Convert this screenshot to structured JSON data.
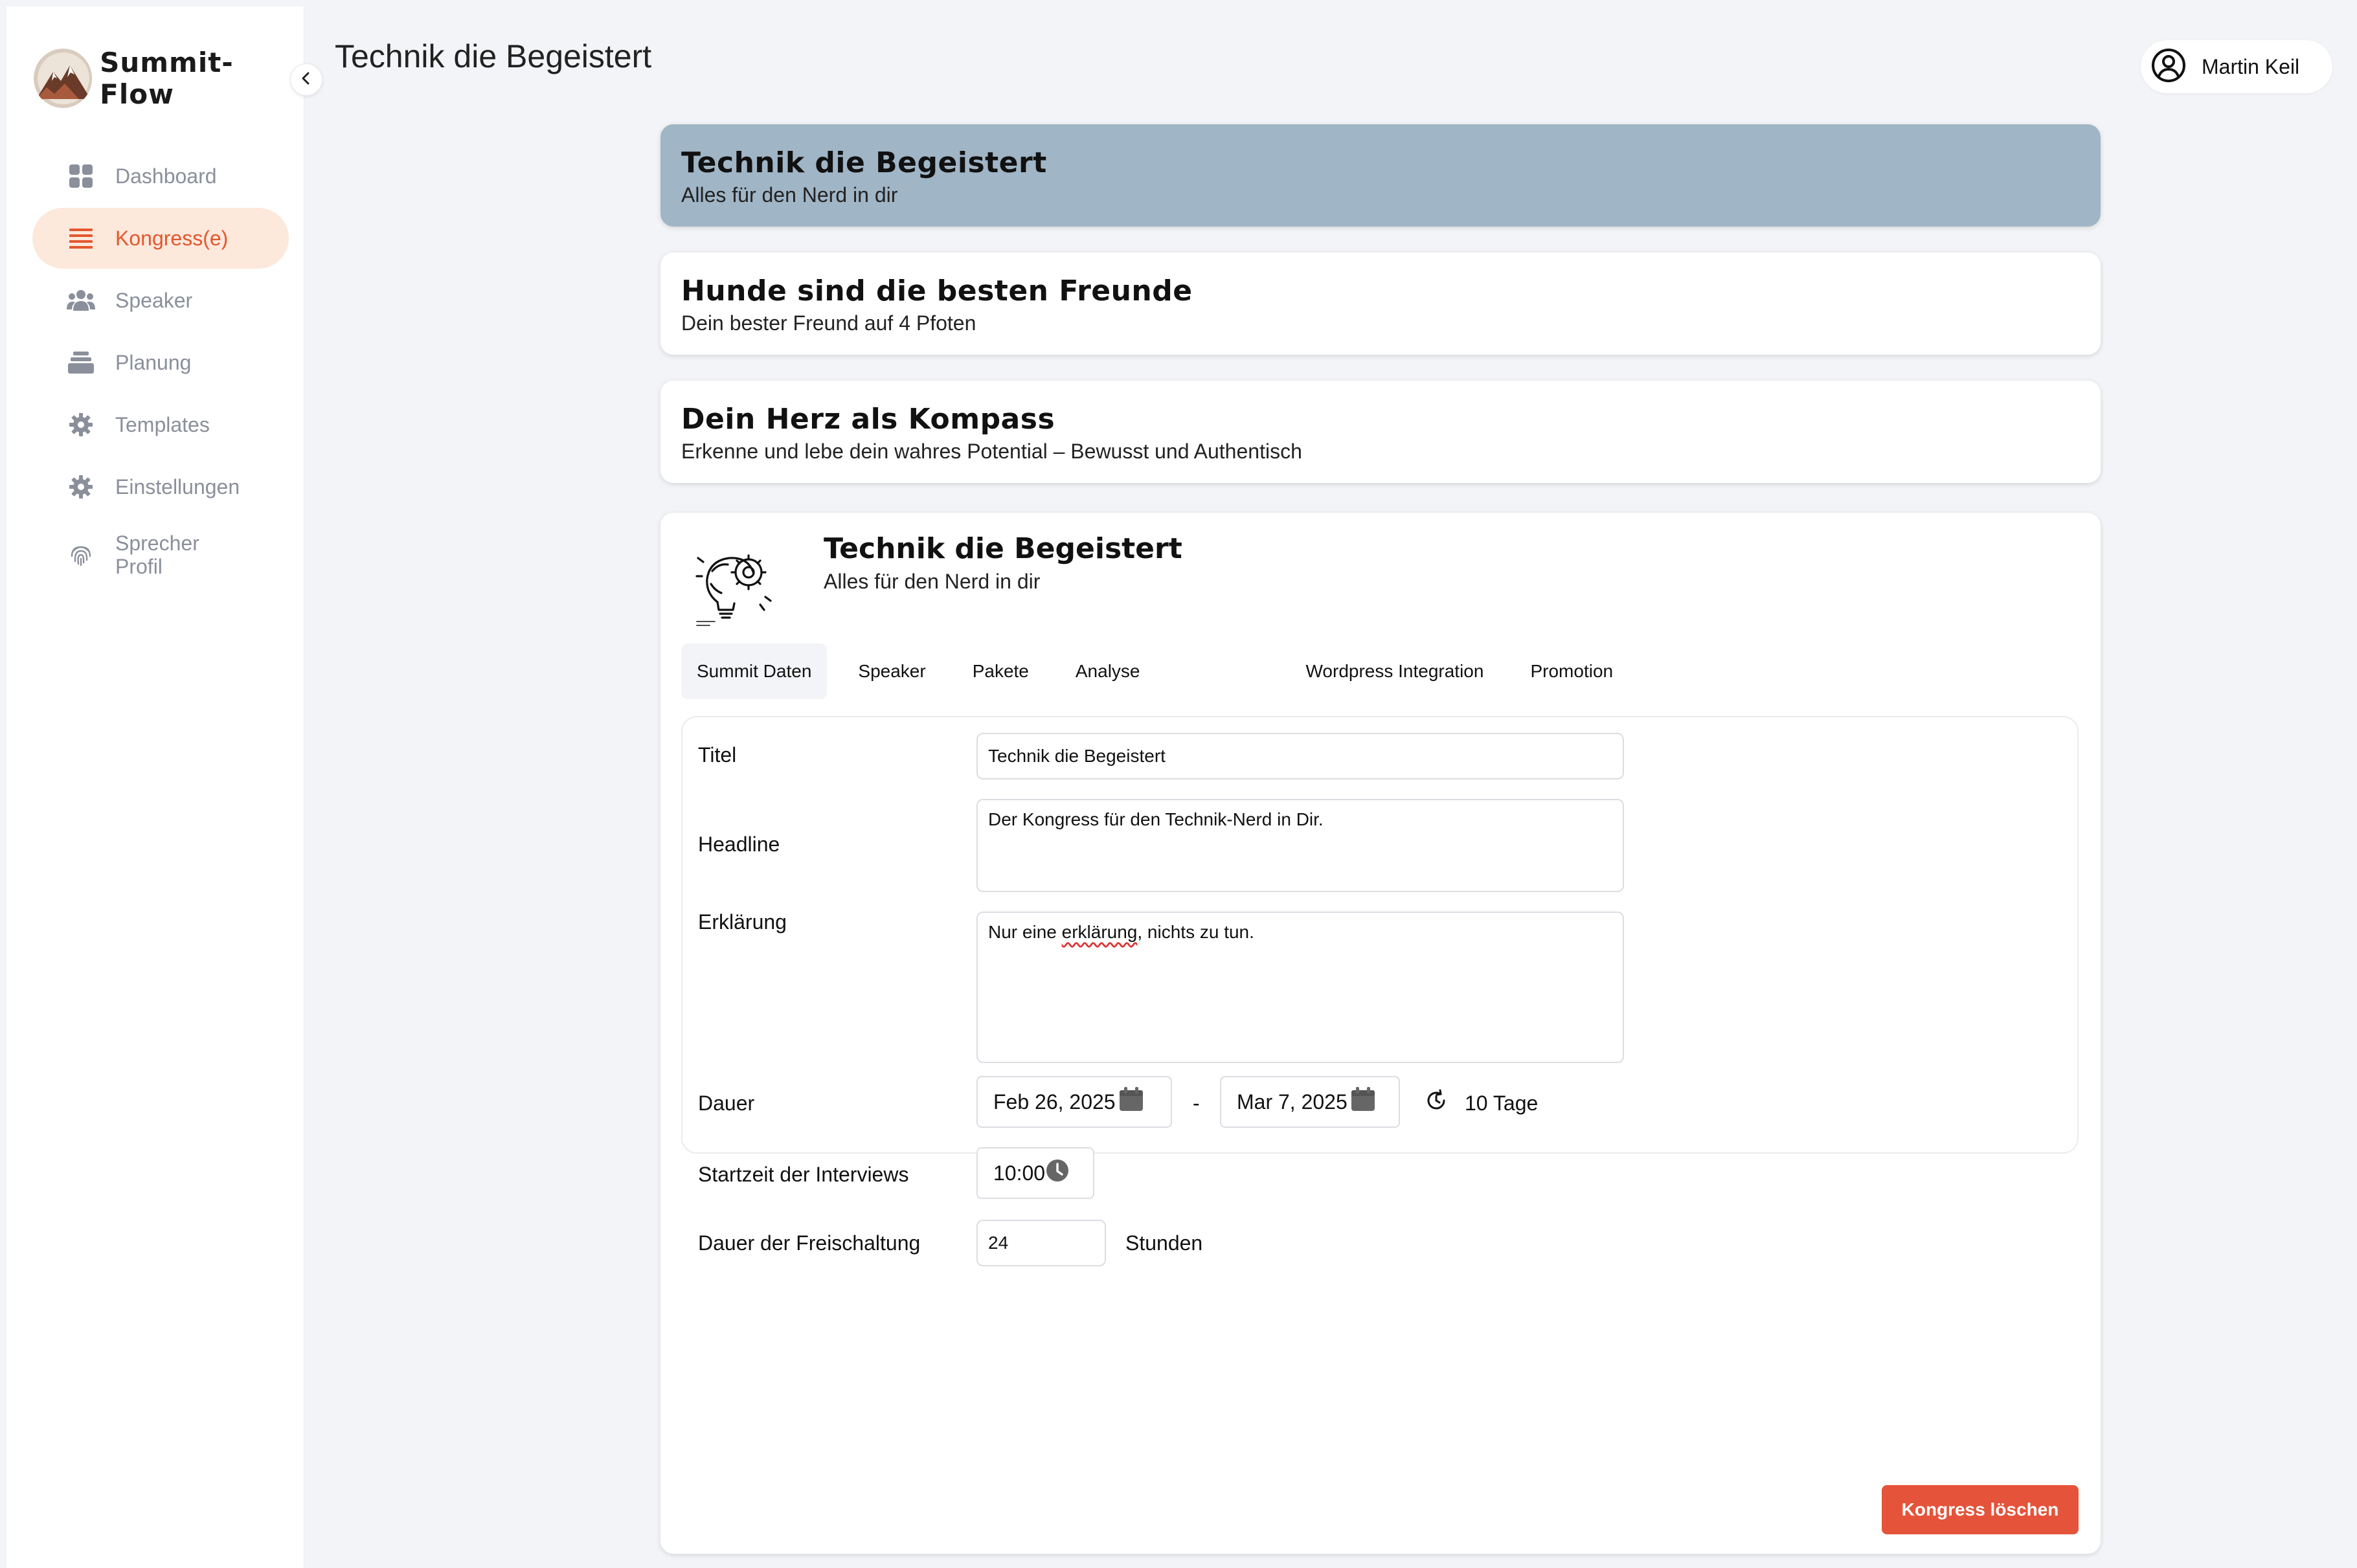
{
  "app": {
    "name": "Summit-Flow"
  },
  "sidebar": {
    "items": [
      {
        "label": "Dashboard",
        "icon": "dashboard-grid-icon",
        "active": false
      },
      {
        "label": "Kongress(e)",
        "icon": "list-icon",
        "active": true
      },
      {
        "label": "Speaker",
        "icon": "people-icon",
        "active": false
      },
      {
        "label": "Planung",
        "icon": "layers-icon",
        "active": false
      },
      {
        "label": "Templates",
        "icon": "gear-icon",
        "active": false
      },
      {
        "label": "Einstellungen",
        "icon": "gear-icon",
        "active": false
      },
      {
        "label": "Sprecher Profil",
        "icon": "fingerprint-icon",
        "active": false
      }
    ]
  },
  "header": {
    "title": "Technik die Begeistert",
    "user": {
      "name": "Martin Keil"
    }
  },
  "congresses": [
    {
      "title": "Technik die Begeistert",
      "subtitle": "Alles für den Nerd in dir",
      "selected": true
    },
    {
      "title": "Hunde sind die besten Freunde",
      "subtitle": "Dein bester Freund auf 4 Pfoten",
      "selected": false
    },
    {
      "title": "Dein Herz als Kompass",
      "subtitle": "Erkenne und lebe dein wahres Potential – Bewusst und Authentisch",
      "selected": false
    }
  ],
  "detail": {
    "title": "Technik die Begeistert",
    "subtitle": "Alles für den Nerd in dir",
    "tabs": [
      "Summit Daten",
      "Speaker",
      "Pakete",
      "Analyse",
      "Wordpress Integration",
      "Promotion"
    ],
    "active_tab": "Summit Daten",
    "form": {
      "titel_label": "Titel",
      "titel_value": "Technik die Begeistert",
      "headline_label": "Headline",
      "headline_value": "Der Kongress für den Technik-Nerd in Dir.",
      "erklaerung_label": "Erklärung",
      "erklaerung_before": "Nur eine ",
      "erklaerung_misspelled": "erklärung",
      "erklaerung_after": ", nichts zu tun.",
      "dauer_label": "Dauer",
      "start_date": "Feb 26, 2025",
      "end_date": "Mar 7, 2025",
      "range_separator": "-",
      "duration_text": "10 Tage",
      "startzeit_label": "Startzeit der Interviews",
      "startzeit_value": "10:00",
      "freischaltung_label": "Dauer der Freischaltung",
      "freischaltung_value": "24",
      "freischaltung_unit": "Stunden"
    },
    "delete_button": "Kongress löschen"
  },
  "colors": {
    "accent": "#e4572e",
    "active_nav_bg": "#fde8dc",
    "selected_card_bg": "#a0b5c6",
    "delete_button_bg": "#e5533a",
    "page_bg": "#f3f4f7"
  }
}
